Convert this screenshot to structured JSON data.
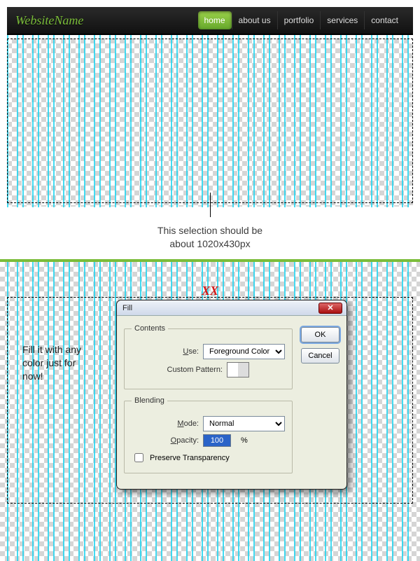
{
  "header": {
    "logo": "WebsiteName",
    "nav": [
      "home",
      "about us",
      "portfolio",
      "services",
      "contact"
    ],
    "active_index": 0
  },
  "annotations": {
    "selection_note_line1": "This selection should be",
    "selection_note_line2": "about 1020x430px",
    "xx": "XX",
    "fill_note_line1": "Fill it with any",
    "fill_note_line2": "color just for",
    "fill_note_line3": "now!"
  },
  "dialog": {
    "title": "Fill",
    "contents_legend": "Contents",
    "use_label": "Use:",
    "use_value": "Foreground Color",
    "custom_pattern_label": "Custom Pattern:",
    "blending_legend": "Blending",
    "mode_label": "Mode:",
    "mode_value": "Normal",
    "opacity_label": "Opacity:",
    "opacity_value": "100",
    "percent": "%",
    "preserve_label": "Preserve Transparency",
    "ok": "OK",
    "cancel": "Cancel"
  }
}
